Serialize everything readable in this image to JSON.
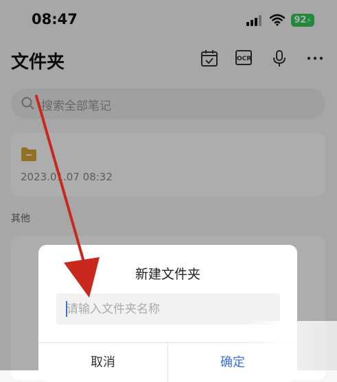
{
  "status_bar": {
    "time": "08:47",
    "battery": "92"
  },
  "header": {
    "title": "文件夹"
  },
  "search": {
    "placeholder": "搜索全部笔记"
  },
  "folder": {
    "date": "2023.01.07 08:32"
  },
  "section": {
    "other_label": "其他"
  },
  "dialog": {
    "title": "新建文件夹",
    "input_placeholder": "请输入文件夹名称",
    "input_value": "",
    "cancel_label": "取消",
    "confirm_label": "确定"
  },
  "colors": {
    "accent": "#3b6fe0",
    "annotation_arrow": "#c8281e",
    "battery": "#34c759"
  },
  "icons": [
    "calendar-check-icon",
    "ocr-icon",
    "microphone-icon",
    "more-icon",
    "search-icon",
    "folder-icon",
    "annotation-arrow"
  ]
}
